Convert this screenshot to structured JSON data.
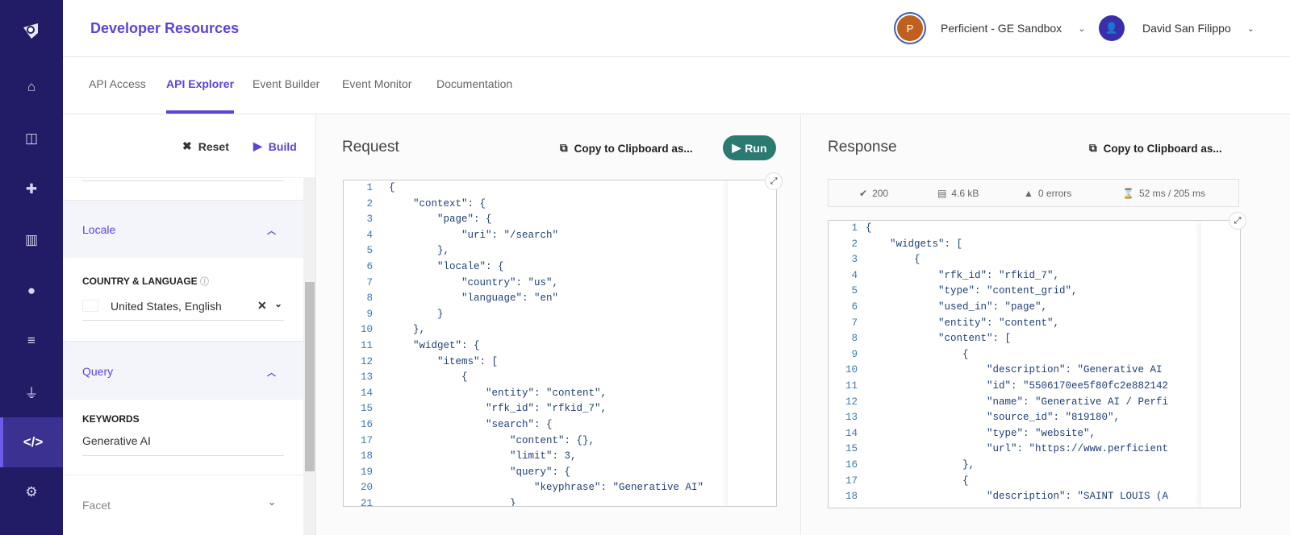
{
  "header": {
    "title": "Developer Resources",
    "org": {
      "initial": "P",
      "name": "Perficient - GE Sandbox"
    },
    "user": {
      "name": "David San Filippo"
    }
  },
  "nav": {
    "icons": [
      "logo-icon",
      "home-icon",
      "layout-icon",
      "puzzle-icon",
      "chart-icon",
      "globe-icon",
      "database-icon",
      "plug-icon",
      "code-icon",
      "gear-icon"
    ],
    "active": "code-icon"
  },
  "tabs": [
    "API Access",
    "API Explorer",
    "Event Builder",
    "Event Monitor",
    "Documentation"
  ],
  "active_tab": "API Explorer",
  "left": {
    "reset": "Reset",
    "build": "Build",
    "sections": [
      {
        "label": "Locale",
        "expanded": true
      },
      {
        "label": "Query",
        "expanded": true
      },
      {
        "label": "Facet",
        "expanded": false
      }
    ],
    "country_label": "COUNTRY & LANGUAGE",
    "country_value": "United States, English",
    "keywords_label": "KEYWORDS",
    "keywords_value": "Generative AI"
  },
  "request": {
    "title": "Request",
    "copy": "Copy to Clipboard as...",
    "run": "Run",
    "lines": [
      "{",
      "    \"context\": {",
      "        \"page\": {",
      "            \"uri\": \"/search\"",
      "        },",
      "        \"locale\": {",
      "            \"country\": \"us\",",
      "            \"language\": \"en\"",
      "        }",
      "    },",
      "    \"widget\": {",
      "        \"items\": [",
      "            {",
      "                \"entity\": \"content\",",
      "                \"rfk_id\": \"rfkid_7\",",
      "                \"search\": {",
      "                    \"content\": {},",
      "                    \"limit\": 3,",
      "                    \"query\": {",
      "                        \"keyphrase\": \"Generative AI\"",
      "                    }"
    ]
  },
  "response": {
    "title": "Response",
    "copy": "Copy to Clipboard as...",
    "stats": {
      "status": "200",
      "size": "4.6 kB",
      "errors": "0 errors",
      "time": "52 ms / 205 ms"
    },
    "lines": [
      "{",
      "    \"widgets\": [",
      "        {",
      "            \"rfk_id\": \"rfkid_7\",",
      "            \"type\": \"content_grid\",",
      "            \"used_in\": \"page\",",
      "            \"entity\": \"content\",",
      "            \"content\": [",
      "                {",
      "                    \"description\": \"Generative AI",
      "                    \"id\": \"5506170ee5f80fc2e882142",
      "                    \"name\": \"Generative AI / Perfi",
      "                    \"source_id\": \"819180\",",
      "                    \"type\": \"website\",",
      "                    \"url\": \"https://www.perficient",
      "                },",
      "                {",
      "                    \"description\": \"SAINT LOUIS (A"
    ]
  },
  "colors": {
    "nav": "#221b66",
    "accent": "#5a45d6",
    "run": "#2a7a72",
    "org_avatar": "#c0601f",
    "user_avatar": "#3a2fa8"
  }
}
